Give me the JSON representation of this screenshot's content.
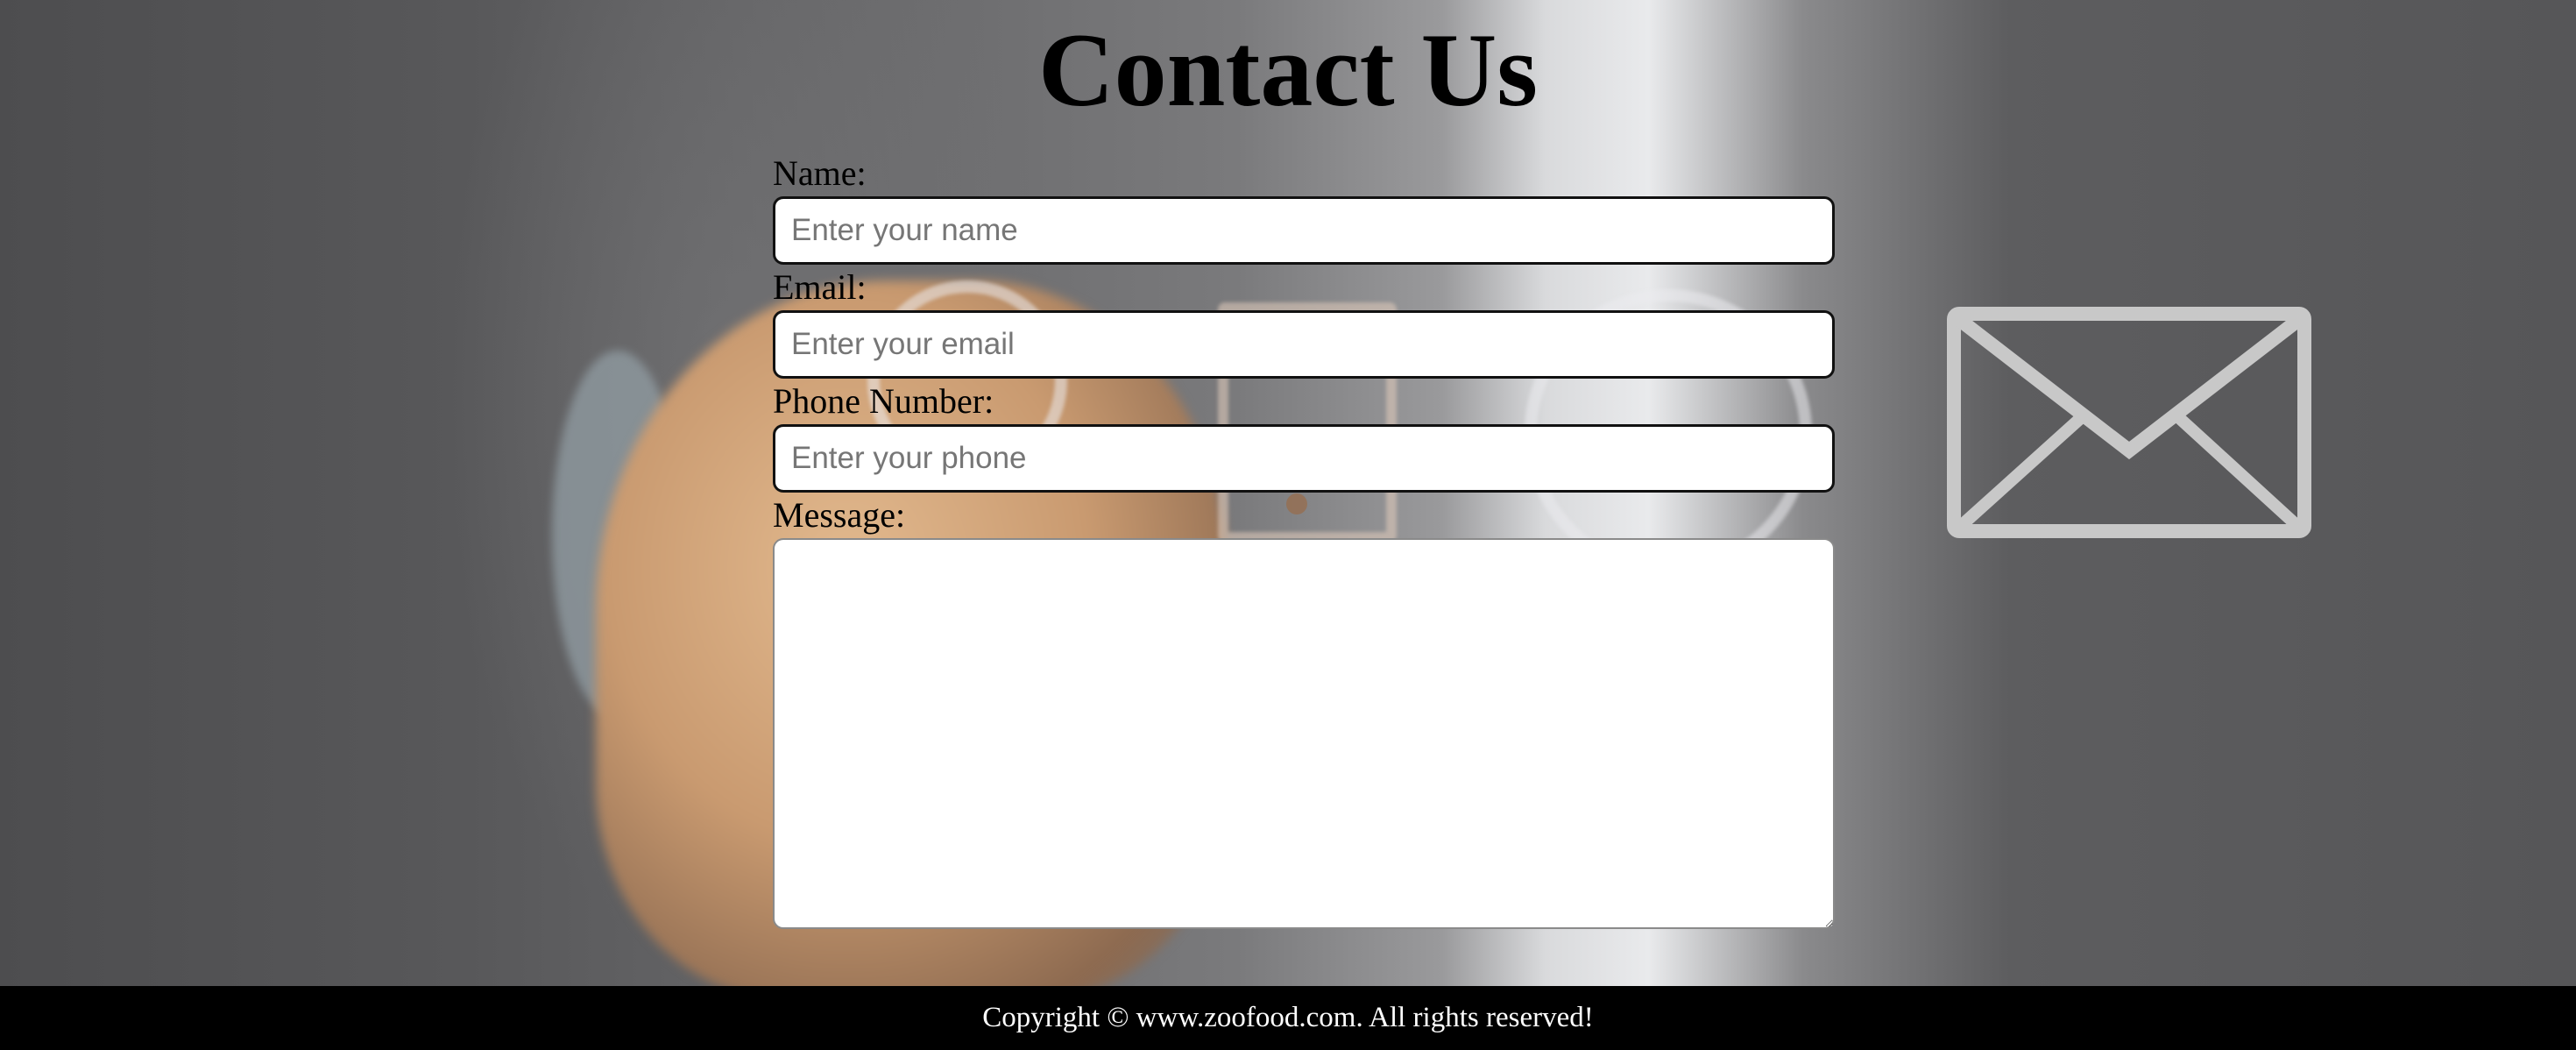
{
  "page": {
    "title": "Contact Us"
  },
  "form": {
    "name_label": "Name:",
    "name_placeholder": "Enter your name",
    "email_label": "Email:",
    "email_placeholder": "Enter your email",
    "phone_label": "Phone Number:",
    "phone_placeholder": "Enter your phone",
    "message_label": "Message:",
    "message_value": ""
  },
  "footer": {
    "copyright": "Copyright © www.zoofood.com. All rights reserved!"
  },
  "colors": {
    "footer_bg": "#000000",
    "footer_text": "#ffffff",
    "background": "#5a5a5c"
  },
  "icons": {
    "background_envelope": "envelope-icon"
  }
}
